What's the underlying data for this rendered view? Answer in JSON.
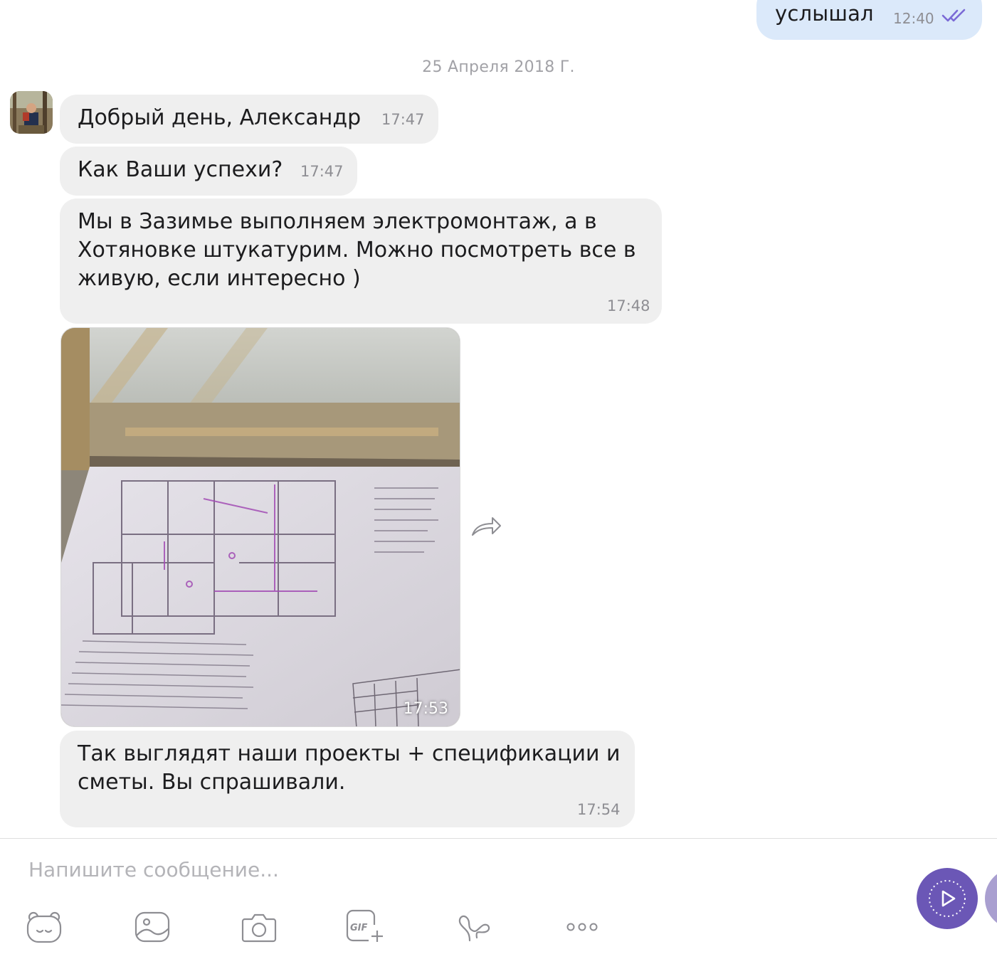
{
  "outgoing_message": {
    "text": "услышал",
    "time": "12:40",
    "status_icon": "double-check-icon"
  },
  "date_separator": "25 Апреля 2018 Г.",
  "contact": {
    "avatar_icon": "contact-avatar"
  },
  "messages": [
    {
      "text": "Добрый день, Александр",
      "time": "17:47"
    },
    {
      "text": "Как Ваши успехи?",
      "time": "17:47"
    },
    {
      "text": "Мы в Зазимье выполняем электромонтаж, а в Хотяновке штукатурим. Можно посмотреть все в живую, если интересно )",
      "time": "17:48"
    },
    {
      "type": "photo",
      "time": "17:53",
      "share_icon": "forward-arrow-icon"
    },
    {
      "text": "Так выглядят наши проекты + спецификации и сметы. Вы спрашивали.",
      "time": "17:54"
    }
  ],
  "composer": {
    "placeholder": "Напишите сообщение...",
    "value": "",
    "send_icon": "send-play-icon"
  },
  "toolbar": {
    "icons": [
      "sticker-icon",
      "gallery-icon",
      "camera-icon",
      "gif-icon",
      "doodle-icon",
      "more-icon"
    ]
  },
  "colors": {
    "outgoing_bubble": "#dbe9fa",
    "incoming_bubble": "#efefef",
    "accent": "#6b57b6",
    "read_check": "#7b6ad6"
  }
}
